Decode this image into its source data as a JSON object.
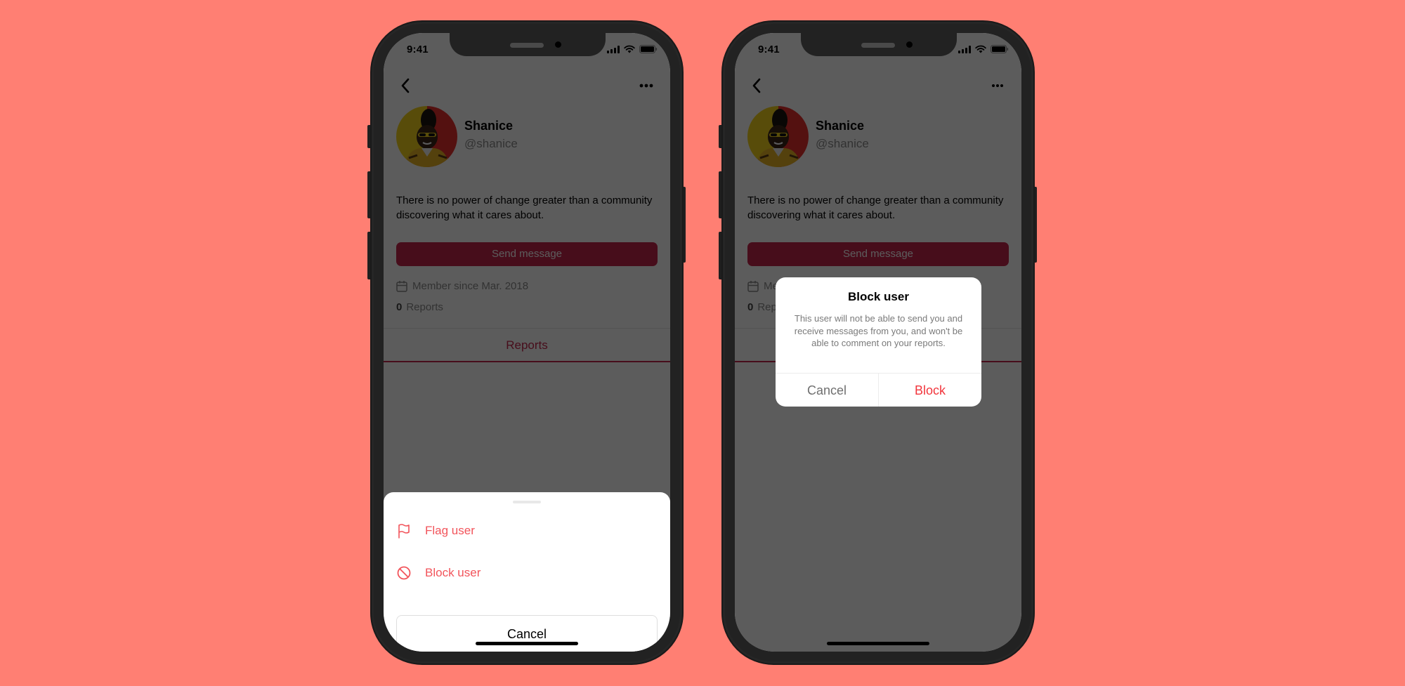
{
  "colors": {
    "background": "#FF7F73",
    "accent": "#C4264D",
    "destructive": "#F2545B"
  },
  "status_bar": {
    "time": "9:41"
  },
  "profile": {
    "name": "Shanice",
    "handle": "@shanice",
    "bio": "There is no power of change greater than a community discovering what it cares about.",
    "send_message_label": "Send message",
    "member_since": "Member since Mar. 2018",
    "reports_count": "0",
    "reports_label": "Reports"
  },
  "tabs": [
    {
      "label": "Reports",
      "active": true
    }
  ],
  "icons": {
    "back": "chevron-left-icon",
    "more": "ellipsis-icon",
    "calendar": "calendar-icon",
    "flag": "flag-icon",
    "block": "block-icon",
    "signal": "cellular-signal-icon",
    "wifi": "wifi-icon",
    "battery": "battery-icon"
  },
  "action_sheet": {
    "items": [
      {
        "label": "Flag user",
        "icon": "flag-icon"
      },
      {
        "label": "Block user",
        "icon": "block-icon"
      }
    ],
    "cancel_label": "Cancel"
  },
  "block_dialog": {
    "title": "Block user",
    "message": "This user will not be able to send you and receive messages from you, and won't be able to comment on your reports.",
    "cancel_label": "Cancel",
    "confirm_label": "Block"
  }
}
